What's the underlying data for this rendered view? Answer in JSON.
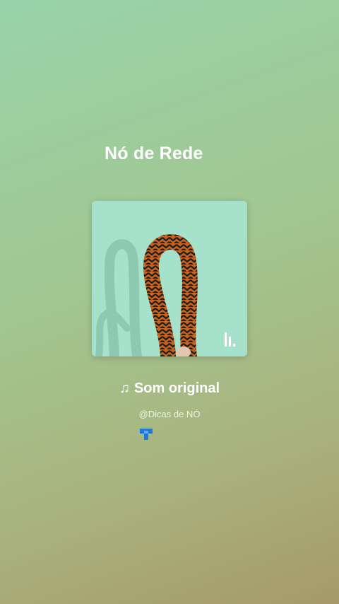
{
  "video": {
    "title": "Nó de Rede"
  },
  "audio": {
    "cover_icon": "knot-rope-photo",
    "play_indicator_icon": "audio-bars-icon",
    "note_icon": "♫",
    "sound_name": "Som original",
    "author": "@Dicas de NÓ",
    "badge_icon": "blue-tag-icon"
  },
  "colors": {
    "text": "#ffffff",
    "cover_bg": "#a8e4cf",
    "rope_orange": "#c8641f",
    "rope_dark": "#1f1f1f",
    "badge_blue": "#1e7ad8"
  }
}
